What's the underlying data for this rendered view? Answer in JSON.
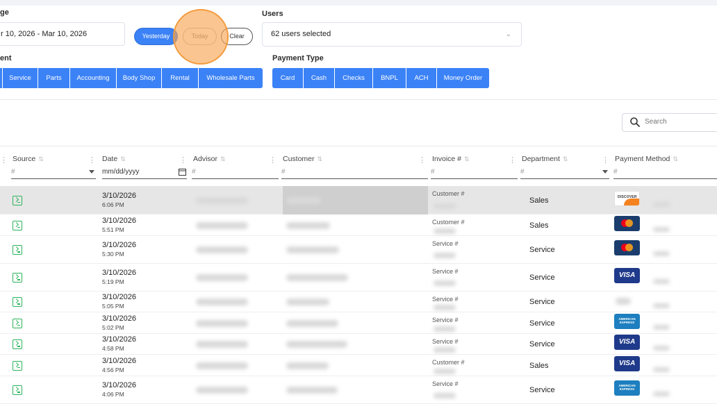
{
  "filters": {
    "date_range_label": "ge",
    "date_range_value": "r 10, 2026 - Mar 10, 2026",
    "quick_buttons": [
      "Yesterday",
      "Today",
      "Clear"
    ],
    "users_label": "Users",
    "users_value": "62 users selected",
    "department_label": "ent",
    "departments": [
      "Service",
      "Parts",
      "Accounting",
      "Body Shop",
      "Rental",
      "Wholesale Parts"
    ],
    "payment_type_label": "Payment Type",
    "payment_types": [
      "Card",
      "Cash",
      "Checks",
      "BNPL",
      "ACH",
      "Money Order"
    ]
  },
  "search": {
    "placeholder": "Search"
  },
  "table": {
    "headers": {
      "source": "Source",
      "date": "Date",
      "advisor": "Advisor",
      "customer": "Customer",
      "invoice": "Invoice #",
      "department": "Department",
      "payment_method": "Payment Method"
    },
    "filter_placeholders": {
      "source": "#",
      "date": "mm/dd/yyyy",
      "advisor": "#",
      "customer": "#",
      "invoice": "#",
      "department": "#",
      "payment_method": "#"
    },
    "sort_icon": "⇅",
    "rows": [
      {
        "date": "3/10/2026",
        "time": "6:06 PM",
        "invoice_label": "Customer #",
        "department": "Sales",
        "card": "discover",
        "card_text": "DISCOVER",
        "selected": true
      },
      {
        "date": "3/10/2026",
        "time": "5:51 PM",
        "invoice_label": "Customer #",
        "department": "Sales",
        "card": "mastercard",
        "card_text": ""
      },
      {
        "date": "3/10/2026",
        "time": "5:30 PM",
        "invoice_label": "Service #",
        "department": "Service",
        "card": "mastercard",
        "card_text": ""
      },
      {
        "date": "3/10/2026",
        "time": "5:19 PM",
        "invoice_label": "Service #",
        "department": "Service",
        "card": "visa",
        "card_text": "VISA"
      },
      {
        "date": "3/10/2026",
        "time": "5:05 PM",
        "invoice_label": "Service #",
        "department": "Service",
        "card": "none",
        "card_text": ""
      },
      {
        "date": "3/10/2026",
        "time": "5:02 PM",
        "invoice_label": "Service #",
        "department": "Service",
        "card": "amex",
        "card_text": "AMERICAN EXPRESS"
      },
      {
        "date": "3/10/2026",
        "time": "4:58 PM",
        "invoice_label": "Service #",
        "department": "Service",
        "card": "visa",
        "card_text": "VISA"
      },
      {
        "date": "3/10/2026",
        "time": "4:56 PM",
        "invoice_label": "Customer #",
        "department": "Sales",
        "card": "visa",
        "card_text": "VISA"
      },
      {
        "date": "3/10/2026",
        "time": "4:06 PM",
        "invoice_label": "Service #",
        "department": "Service",
        "card": "amex",
        "card_text": "AMERICAN EXPRESS"
      }
    ]
  },
  "colors": {
    "accent": "#3b82f6",
    "source_icon": "#2bb35b",
    "highlight": "#f7a654"
  }
}
